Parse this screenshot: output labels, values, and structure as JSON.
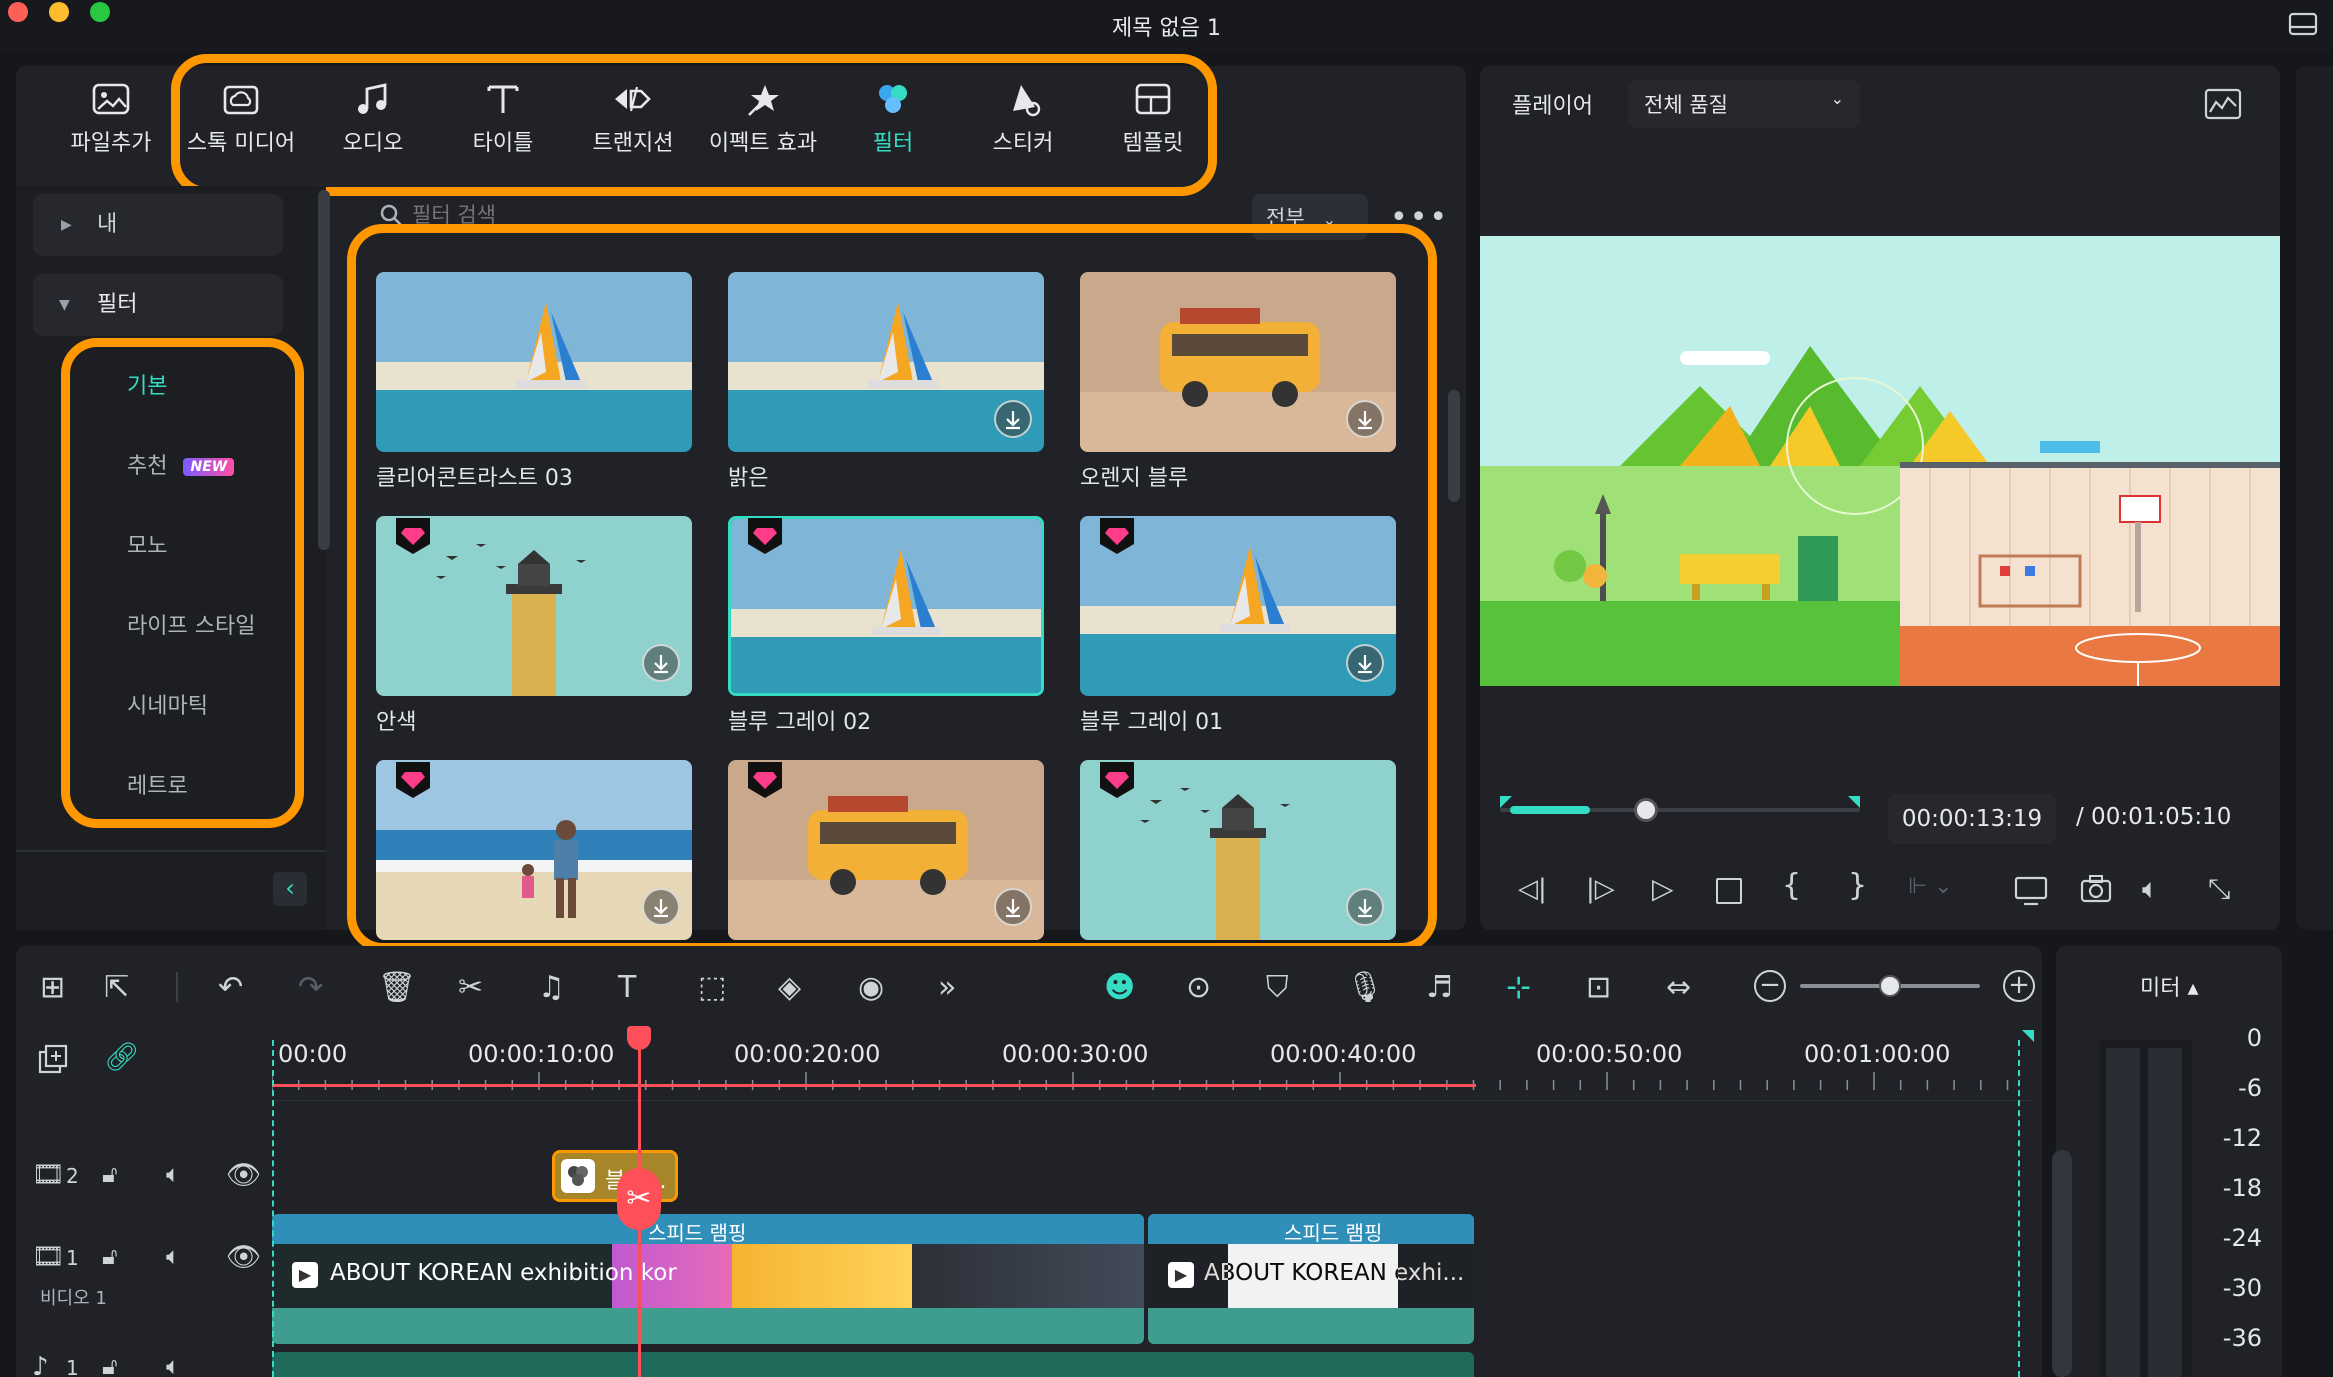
{
  "window": {
    "title": "제목 없음 1"
  },
  "toolbar": {
    "items": [
      {
        "label": "파일추가",
        "icon": "import-icon"
      },
      {
        "label": "스톡 미디어",
        "icon": "stock-media-icon"
      },
      {
        "label": "오디오",
        "icon": "music-note-icon"
      },
      {
        "label": "타이틀",
        "icon": "text-icon"
      },
      {
        "label": "트랜지션",
        "icon": "transition-icon"
      },
      {
        "label": "이펙트 효과",
        "icon": "effects-icon"
      },
      {
        "label": "필터",
        "icon": "filter-icon",
        "active": true
      },
      {
        "label": "스티커",
        "icon": "sticker-icon"
      },
      {
        "label": "템플릿",
        "icon": "template-icon"
      }
    ]
  },
  "sidebar": {
    "my": "내",
    "filter": "필터",
    "categories": [
      "기본",
      "추천",
      "모노",
      "라이프 스타일",
      "시네마틱",
      "레트로"
    ],
    "new_badge": "NEW",
    "active_index": 0
  },
  "search": {
    "placeholder": "필터 검색",
    "scope": "전부"
  },
  "filters": [
    {
      "name": "클리어콘트라스트 03",
      "scene": "sailboat",
      "premium": false,
      "download": false
    },
    {
      "name": "밝은",
      "scene": "sailboat",
      "premium": false,
      "download": true
    },
    {
      "name": "오렌지 블루",
      "scene": "van",
      "premium": false,
      "download": true
    },
    {
      "name": "안색",
      "scene": "lighthouse",
      "premium": true,
      "download": true
    },
    {
      "name": "블루 그레이 02",
      "scene": "sailboat",
      "premium": true,
      "download": false,
      "selected": true
    },
    {
      "name": "블루 그레이 01",
      "scene": "sailboat",
      "premium": true,
      "download": true
    },
    {
      "name": "",
      "scene": "beach",
      "premium": true,
      "download": true
    },
    {
      "name": "",
      "scene": "van",
      "premium": true,
      "download": true
    },
    {
      "name": "",
      "scene": "lighthouse",
      "premium": true,
      "download": true
    }
  ],
  "player": {
    "tab": "플레이어",
    "quality": "전체 품질",
    "current_time": "00:00:13:19",
    "total_time": "/ 00:01:05:10",
    "progress": 0.2
  },
  "timeline": {
    "ruler": [
      "00:00",
      "00:00:10:00",
      "00:00:20:00",
      "00:00:30:00",
      "00:00:40:00",
      "00:00:50:00",
      "00:01:00:00"
    ],
    "tracks": [
      {
        "num": "2"
      },
      {
        "num": "1",
        "name": "비디오 1"
      },
      {
        "num": "1"
      }
    ],
    "filter_clip": "블루...",
    "clips": [
      {
        "title": "ABOUT KOREAN exhibition kor",
        "header": "스피드 램핑"
      },
      {
        "title": "ABOUT KOREAN exhi...",
        "header": "스피드 램핑"
      }
    ],
    "zoom": 0.5
  },
  "meter": {
    "label": "미터 ▴",
    "scale": [
      "0",
      "-6",
      "-12",
      "-18",
      "-24",
      "-30",
      "-36"
    ]
  },
  "colors": {
    "accent": "#35dcc4",
    "highlight": "#ff9800",
    "playhead": "#ff4f58"
  }
}
